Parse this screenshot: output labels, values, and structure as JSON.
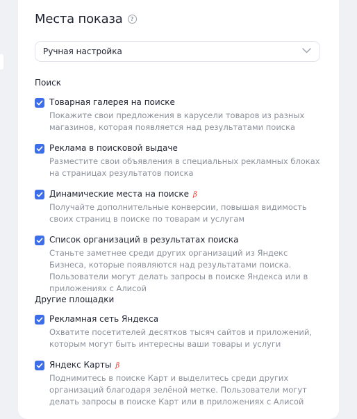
{
  "header": {
    "title": "Места показа",
    "help_icon": "question-circle-icon"
  },
  "select": {
    "value": "Ручная настройка",
    "icon": "chevron-down-icon"
  },
  "sections": [
    {
      "title": "Поиск",
      "options": [
        {
          "title": "Товарная галерея на поиске",
          "beta": "",
          "checked": true,
          "description": "Покажите свои предложения в карусели товаров из разных магазинов, которая появляется над результатами поиска"
        },
        {
          "title": "Реклама в поисковой выдаче",
          "beta": "",
          "checked": true,
          "description": "Разместите свои объявления в специальных рекламных блоках на страницах результатов поиска"
        },
        {
          "title": "Динамические места на поиске",
          "beta": "β",
          "checked": true,
          "description": "Получайте дополнительные конверсии, повышая видимость своих страниц в поиске по товарам и услугам"
        },
        {
          "title": "Список организаций в результатах поиска",
          "beta": "",
          "checked": true,
          "description": "Станьте заметнее среди других организаций из Яндекс Бизнеса, которые появляются над результатами поиска. Пользователи могут делать запросы в поиске Яндекса или в приложениях с Алисой"
        }
      ]
    },
    {
      "title": "Другие площадки",
      "options": [
        {
          "title": "Рекламная сеть Яндекса",
          "beta": "",
          "checked": true,
          "description": "Охватите посетителей десятков тысяч сайтов и приложений, которым могут быть интересны ваши товары и услуги"
        },
        {
          "title": "Яндекс Карты",
          "beta": "β",
          "checked": true,
          "description": "Поднимитесь в поиске Карт и выделитесь среди других организаций благодаря зелёной метке. Пользователи могут делать запросы в поиске Карт или в приложениях с Алисой"
        }
      ]
    }
  ],
  "colors": {
    "accent": "#3d6ee8",
    "beta": "#e8443a",
    "description": "#8a8f99"
  }
}
